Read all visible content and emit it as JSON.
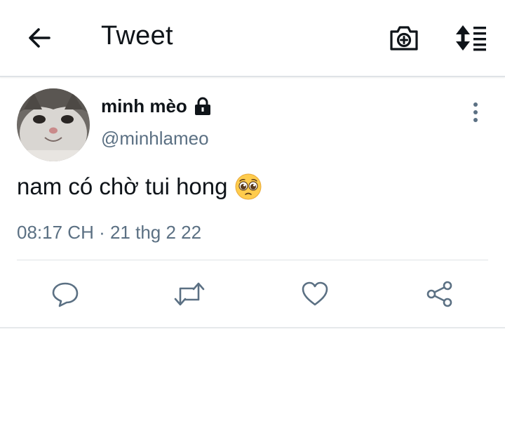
{
  "header": {
    "title": "Tweet",
    "back_icon": "arrow-left-icon",
    "camera_icon": "camera-plus-icon",
    "sort_icon": "sort-list-icon"
  },
  "tweet": {
    "author": {
      "display_name": "minh mèo",
      "handle": "@minhlameo",
      "protected_icon": "lock-icon",
      "avatar": "cat-avatar"
    },
    "text": "nam có chờ tui hong",
    "emoji": "pleading-face-emoji",
    "timestamp": "08:17 CH · 21 thg 2 22",
    "more_icon": "more-vertical-icon",
    "actions": {
      "reply_icon": "reply-bubble-icon",
      "retweet_icon": "retweet-icon",
      "like_icon": "heart-icon",
      "share_icon": "share-icon"
    }
  },
  "colors": {
    "text_primary": "#0f1419",
    "text_secondary": "#5b7083",
    "divider": "#dfe3e6"
  }
}
